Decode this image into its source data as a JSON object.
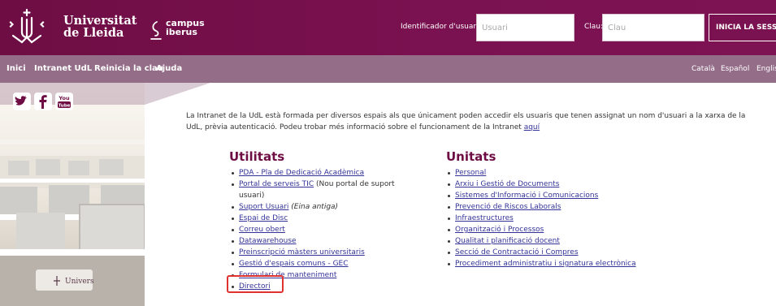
{
  "header": {
    "logo_line1": "Universitat",
    "logo_line2": "de Lleida",
    "campus_line1": "campus",
    "campus_line2": "iberus"
  },
  "login": {
    "user_label": "Identificador d'usuari",
    "user_placeholder": "Usuari",
    "pass_label": "Clau:",
    "pass_placeholder": "Clau",
    "button_label": "INICIA LA SESSIÓ"
  },
  "nav": {
    "items": [
      {
        "label": "Inici"
      },
      {
        "label": "Intranet UdL"
      },
      {
        "label": "Reinicia la clau"
      },
      {
        "label": "Ajuda"
      }
    ],
    "languages": [
      {
        "label": "Català"
      },
      {
        "label": "Español"
      },
      {
        "label": "English"
      }
    ]
  },
  "social": {
    "icons": [
      "twitter-icon",
      "facebook-icon",
      "youtube-icon"
    ]
  },
  "intro": {
    "text": "La Intranet de la UdL està formada per diversos espais als que únicament poden accedir els usuaris que tenen assignat un nom d'usuari a la xarxa de la UdL, prèvia autenticació. Podeu trobar més informació sobre el funcionament de la Intranet ",
    "link": "aquí"
  },
  "utilitats": {
    "title": "Utilitats",
    "items": [
      {
        "label": "PDA - Pla de Dedicació Acadèmica",
        "note": ""
      },
      {
        "label": "Portal de serveis TIC",
        "note": " (Nou portal de suport usuari)"
      },
      {
        "label": "Suport Usuari",
        "note": " (Eina antiga)"
      },
      {
        "label": "Espai de Disc",
        "note": ""
      },
      {
        "label": "Correu obert",
        "note": ""
      },
      {
        "label": "Datawarehouse",
        "note": ""
      },
      {
        "label": "Preinscripció màsters universitaris",
        "note": ""
      },
      {
        "label": "Gestió d'espais comuns - GEC",
        "note": ""
      },
      {
        "label": "Formulari de manteniment",
        "note": ""
      },
      {
        "label": "Directori",
        "note": ""
      }
    ]
  },
  "unitats": {
    "title": "Unitats",
    "items": [
      {
        "label": "Personal"
      },
      {
        "label": "Arxiu i Gestió de Documents"
      },
      {
        "label": "Sistemes d'Informació i Comunicacions"
      },
      {
        "label": "Prevenció de Riscos Laborals"
      },
      {
        "label": "Infraestructures"
      },
      {
        "label": "Organització i Processos"
      },
      {
        "label": "Qualitat i planificació docent"
      },
      {
        "label": "Secció de Contractació i Compres"
      },
      {
        "label": "Procediment administratiu i signatura electrònica"
      }
    ]
  },
  "colors": {
    "brand": "#7a1150",
    "nav": "#946d88",
    "title": "#6e0d44",
    "link": "#333399",
    "highlight": "#e0332f"
  }
}
